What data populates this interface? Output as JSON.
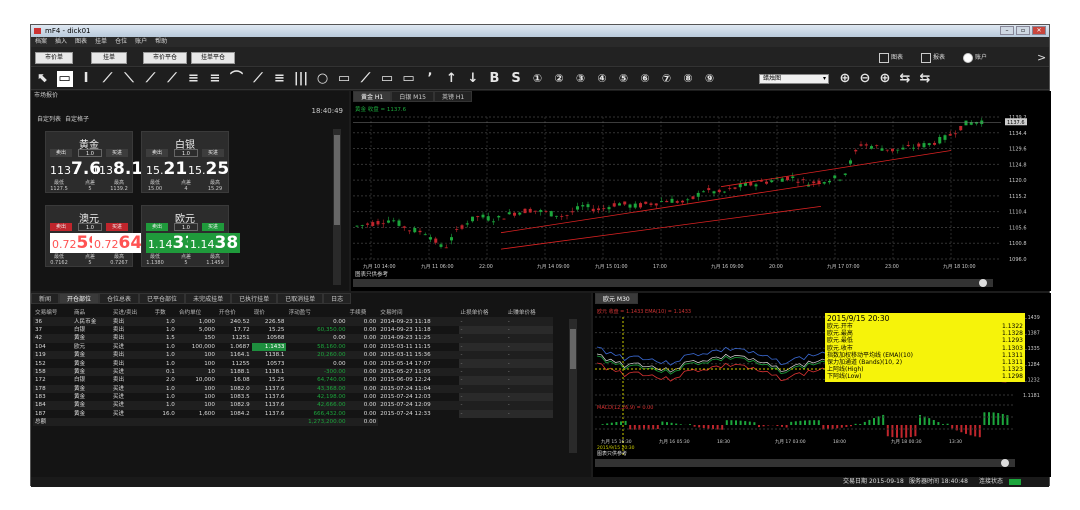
{
  "window": {
    "title": "mF4 - dick01"
  },
  "menu": [
    "档案",
    "插入",
    "图表",
    "挂单",
    "仓位",
    "账户",
    "帮助"
  ],
  "toolbar1": {
    "market": "市价单",
    "limit": "挂单",
    "close_market": "市价平仓",
    "close_limit": "挂单平仓",
    "charts": "图表",
    "report": "报表",
    "account": "账户"
  },
  "toolbar2": {
    "tools": [
      "⬉",
      "▭",
      "I",
      "⟋",
      "⟍",
      "⟋",
      "⟋",
      "≡",
      "≡",
      "⌒",
      "⟋",
      "≡",
      "|||",
      "○",
      "▭",
      "⟋",
      "▭",
      "▭",
      "ʼ",
      "↑",
      "↓",
      "B",
      "S",
      "①",
      "②",
      "③",
      "④",
      "⑤",
      "⑥",
      "⑦",
      "⑧",
      "⑨"
    ],
    "period": "蜡烛图",
    "zoom": [
      "⊕",
      "⊖",
      "⊕",
      "⇆",
      "⇆"
    ]
  },
  "market": {
    "title": "市场报价",
    "time": "18:40:49",
    "tabs": [
      "自定列表",
      "自定格子"
    ]
  },
  "quotes": [
    {
      "name": "黄金",
      "sell": "卖出",
      "buy": "买进",
      "lot": "1.0",
      "bid_a": "113",
      "bid_b": "7.6",
      "ask_a": "113",
      "ask_b": "8.1",
      "low_lbl": "最低",
      "spread_lbl": "点差",
      "high_lbl": "最高",
      "low": "1127.5",
      "spread": "5",
      "high": "1139.2",
      "color": "normal"
    },
    {
      "name": "白银",
      "sell": "卖出",
      "buy": "买进",
      "lot": "1.0",
      "bid_a": "15.",
      "bid_b": "21",
      "ask_a": "15.",
      "ask_b": "25",
      "low_lbl": "最低",
      "spread_lbl": "点差",
      "high_lbl": "最高",
      "low": "15.00",
      "spread": "4",
      "high": "15.29",
      "color": "normal"
    },
    {
      "name": "澳元",
      "sell": "卖出",
      "buy": "买进",
      "lot": "1.0",
      "bid_a": "0.72",
      "bid_b": "59",
      "ask_a": "0.72",
      "ask_b": "64",
      "low_lbl": "最低",
      "spread_lbl": "点差",
      "high_lbl": "最高",
      "low": "0.7162",
      "spread": "5",
      "high": "0.7267",
      "color": "red"
    },
    {
      "name": "欧元",
      "sell": "卖出",
      "buy": "买进",
      "lot": "1.0",
      "bid_a": "1.14",
      "bid_b": "33",
      "ask_a": "1.14",
      "ask_b": "38",
      "low_lbl": "最低",
      "spread_lbl": "点差",
      "high_lbl": "最高",
      "low": "1.1380",
      "spread": "5",
      "high": "1.1459",
      "color": "green"
    }
  ],
  "chart_tabs": [
    "黄金 H1",
    "白银 M15",
    "英镑 H1"
  ],
  "main_chart": {
    "header": "黄金 收盘 = 1137.6",
    "ref": "图表只供参考",
    "y_labels": [
      "1139.2",
      "1134.4",
      "1129.6",
      "1124.8",
      "1120.0",
      "1115.2",
      "1110.4",
      "1105.6",
      "1100.8",
      "1096.0"
    ],
    "x_labels": [
      "九月 10 14:00",
      "九月 11 06:00",
      "22:00",
      "九月 14 09:00",
      "九月 15 01:00",
      "17:00",
      "九月 16 09:00",
      "20:00",
      "九月 17 07:00",
      "23:00",
      "九月 18 10:00"
    ],
    "last": "1137.6"
  },
  "orders": {
    "tabs": [
      "新闻",
      "开仓部位",
      "仓位总表",
      "已平仓部位",
      "未完成挂单",
      "已执行挂单",
      "已取消挂单",
      "日志"
    ],
    "headers": [
      "交易编号",
      "商品",
      "买进/卖出",
      "手数",
      "合约单位",
      "开仓价",
      "现价",
      "浮动盈亏",
      "手续费",
      "交易时间",
      "止损单价格",
      "止赚单价格"
    ],
    "rows": [
      [
        "36",
        "人民币金",
        "卖出",
        "1.0",
        "1,000",
        "240.52",
        "226.58",
        "0.00",
        "0.00",
        "2014-09-23 11:18"
      ],
      [
        "37",
        "白银",
        "卖出",
        "1.0",
        "5,000",
        "17.72",
        "15.25",
        "60,350.00",
        "0.00",
        "2014-09-23 11:18"
      ],
      [
        "42",
        "黄金",
        "卖出",
        "1.5",
        "150",
        "11251",
        "10568",
        "0.00",
        "0.00",
        "2014-09-23 11:25"
      ],
      [
        "104",
        "欧元",
        "买进",
        "1.0",
        "100,000",
        "1.0687",
        "1.1433",
        "58,160.00",
        "0.00",
        "2015-03-11 11:15"
      ],
      [
        "119",
        "黄金",
        "卖出",
        "1.0",
        "100",
        "1164.1",
        "1138.1",
        "20,260.00",
        "0.00",
        "2015-03-11 15:36"
      ],
      [
        "152",
        "黄金",
        "卖出",
        "1.0",
        "100",
        "11255",
        "10573",
        "0.00",
        "0.00",
        "2015-05-14 17:07"
      ],
      [
        "158",
        "黄金",
        "买进",
        "0.1",
        "10",
        "1188.1",
        "1138.1",
        "-300.00",
        "0.00",
        "2015-05-27 11:05"
      ],
      [
        "172",
        "白银",
        "卖出",
        "2.0",
        "10,000",
        "16.08",
        "15.25",
        "64,740.00",
        "0.00",
        "2015-06-09 12:24"
      ],
      [
        "178",
        "黄金",
        "买进",
        "1.0",
        "100",
        "1082.0",
        "1137.6",
        "43,368.00",
        "0.00",
        "2015-07-24 11:04"
      ],
      [
        "183",
        "黄金",
        "买进",
        "1.0",
        "100",
        "1083.5",
        "1137.6",
        "42,198.00",
        "0.00",
        "2015-07-24 12:03"
      ],
      [
        "184",
        "黄金",
        "买进",
        "1.0",
        "100",
        "1082.9",
        "1137.6",
        "42,666.00",
        "0.00",
        "2015-07-24 12:09"
      ],
      [
        "187",
        "黄金",
        "买进",
        "16.0",
        "1,600",
        "1084.2",
        "1137.6",
        "666,432.00",
        "0.00",
        "2015-07-24 12:33"
      ]
    ],
    "total_label": "总额",
    "total": "1,273,200.00",
    "total_fee": "0.00",
    "sl": "-",
    "tp": "-"
  },
  "sub_chart": {
    "title": "欧元 M30",
    "header": "欧元 收盘 = 1.1433 EMA(10) = 1.1433",
    "macd": "MACD(12,26,9) = 0.00",
    "ref": "图表只供参考",
    "y_labels": [
      "1.1439",
      "1.1387",
      "1.1335",
      "1.1284",
      "1.1232",
      "1.1181"
    ],
    "x_labels": [
      "九月 15 16:30",
      "九月 16 05:30",
      "18:30",
      "九月 17 03:00",
      "18:00",
      "九月 18 00:30",
      "13:30"
    ],
    "cursor_label": "2015/9/15 20:30",
    "tooltip": {
      "date": "2015/9/15 20:30",
      "rows": [
        [
          "欧元.开市",
          "1.1322"
        ],
        [
          "欧元.最高",
          "1.1328"
        ],
        [
          "欧元.最低",
          "1.1293"
        ],
        [
          "欧元.收市",
          "1.1303"
        ],
        [
          "指数加权移动平均线 (EMA)(10)",
          "1.1311"
        ],
        [
          "保力加通道 (Bands)(10, 2)",
          "1.1311"
        ],
        [
          "上阿线(High)",
          "1.1323"
        ],
        [
          "下阿线(Low)",
          "1.1298"
        ]
      ]
    }
  },
  "status": {
    "trade_date_lbl": "交易日期",
    "trade_date": "2015-09-18",
    "server_lbl": "服务器时间",
    "server": "18:40:48",
    "conn": "连接状态"
  },
  "colors": {
    "up": "#1ca63c",
    "down": "#c0252c",
    "bg": "#1c1c1c",
    "accent": "#f6f30a"
  }
}
